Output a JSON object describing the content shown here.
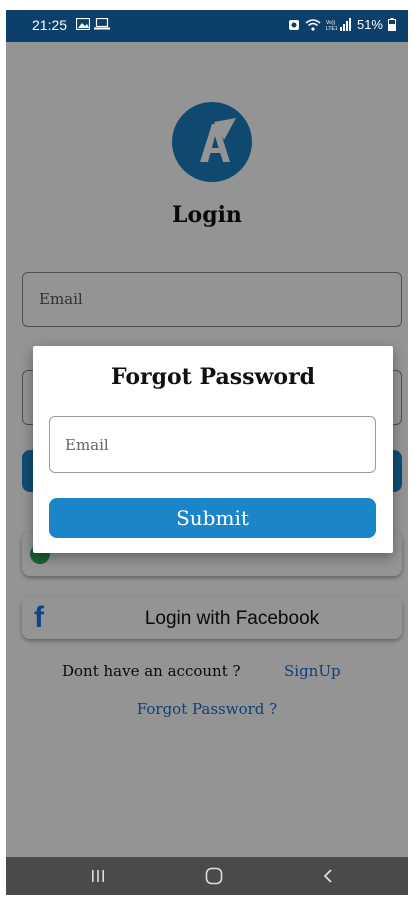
{
  "status_bar": {
    "time": "21:25",
    "battery": "51%",
    "network_label": "Vo)) LTE1"
  },
  "login": {
    "title": "Login",
    "email_placeholder": "Email",
    "facebook_label": "Login with Facebook",
    "signup_prompt": "Dont have an account ?",
    "signup_link": "SignUp",
    "forgot_link": "Forgot Password ?"
  },
  "dialog": {
    "title": "Forgot Password",
    "email_placeholder": "Email",
    "submit_label": "Submit"
  },
  "colors": {
    "status_bar": "#0d3f6b",
    "accent": "#1a86c9",
    "link": "#1a6fc4",
    "logo": "#1a7fc1"
  }
}
